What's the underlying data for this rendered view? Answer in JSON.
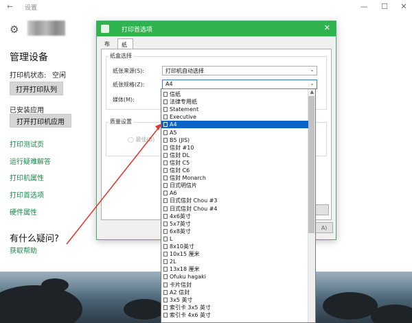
{
  "window": {
    "title": "设置",
    "back_icon": "back-arrow-icon"
  },
  "left": {
    "heading": "管理设备",
    "status_label": "打印机状态:",
    "status_value": "空闲",
    "open_queue": "打开打印队列",
    "installed_label": "已安装应用",
    "open_app": "打开打印机应用",
    "links": [
      "打印测试页",
      "运行疑难解答",
      "打印机属性",
      "打印首选项",
      "硬件属性"
    ],
    "question": "有什么疑问?",
    "help": "获取帮助"
  },
  "dialog": {
    "title": "打印首选项",
    "tabs": [
      "布局",
      "纸张/质量"
    ],
    "group_paper": "纸盒选择",
    "source_label": "纸张来源(S):",
    "source_value": "打印机自动选择",
    "size_label": "纸张规格(Z):",
    "size_value": "A4",
    "media_label": "媒体(M):",
    "group_quality": "质量设置",
    "quality_option": "最佳(B)",
    "ok_fragment": "A)"
  },
  "dropdown": {
    "selected_index": 4,
    "items": [
      "信纸",
      "法律专用纸",
      "Statement",
      "Executive",
      "A4",
      "A5",
      "B5 (JIS)",
      "信封 #10",
      "信封 DL",
      "信封 C5",
      "信封 C6",
      "信封 Monarch",
      "日式明信片",
      "A6",
      "日式信封 Chou #3",
      "日式信封 Chou #4",
      "4x6英寸",
      "5x7英寸",
      "6x8英寸",
      "L",
      "8x10英寸",
      "10x15 厘米",
      "2L",
      "13x18 厘米",
      "Ofuku hagaki",
      "卡片信封",
      "A2 信封",
      "3x5 英寸",
      "索引卡 3x5 英寸",
      "索引卡 4x6 英寸"
    ]
  },
  "colors": {
    "accent": "#2fb34f",
    "link": "#1a8b4a",
    "selection": "#0a64c8",
    "annotation_arrow": "#e03a2f"
  }
}
